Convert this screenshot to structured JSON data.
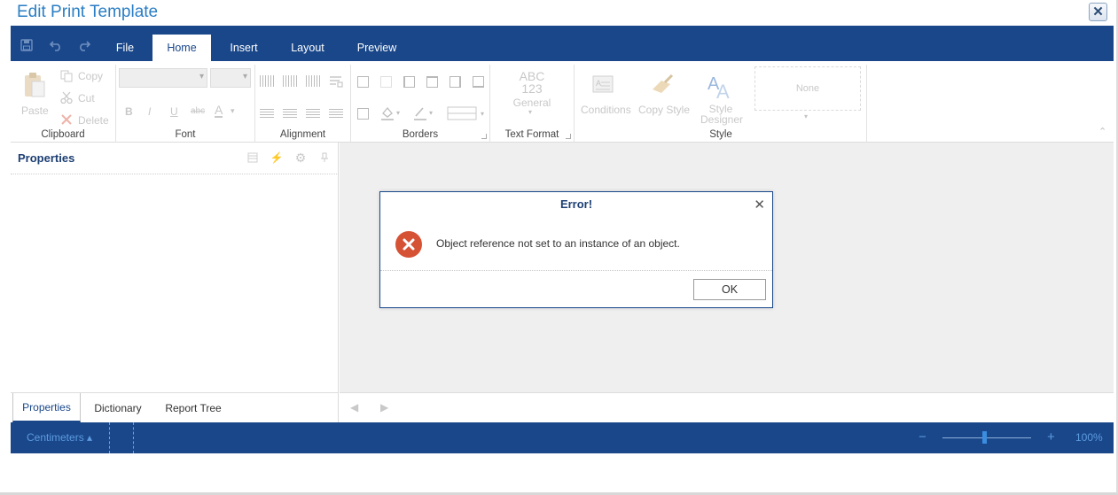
{
  "window": {
    "title": "Edit Print Template",
    "close_label": "✕"
  },
  "menu": {
    "tabs": [
      {
        "label": "File",
        "active": false
      },
      {
        "label": "Home",
        "active": true
      },
      {
        "label": "Insert",
        "active": false
      },
      {
        "label": "Layout",
        "active": false
      },
      {
        "label": "Preview",
        "active": false
      }
    ],
    "quick_access": [
      "save-icon",
      "undo-icon",
      "redo-icon"
    ]
  },
  "ribbon": {
    "clipboard": {
      "label": "Clipboard",
      "paste": "Paste",
      "copy": "Copy",
      "cut": "Cut",
      "delete": "Delete"
    },
    "font": {
      "label": "Font",
      "bold": "B",
      "italic": "I",
      "underline": "U",
      "strike": "abc",
      "color": "A"
    },
    "alignment": {
      "label": "Alignment"
    },
    "borders": {
      "label": "Borders"
    },
    "text_format": {
      "label": "Text Format",
      "abc": "ABC",
      "num": "123",
      "general": "General"
    },
    "style": {
      "label": "Style",
      "conditions": "Conditions",
      "copy_style": "Copy Style",
      "style_designer_1": "Style",
      "style_designer_2": "Designer",
      "none": "None"
    }
  },
  "properties": {
    "title": "Properties",
    "tabs": [
      {
        "label": "Properties",
        "active": true
      },
      {
        "label": "Dictionary",
        "active": false
      },
      {
        "label": "Report Tree",
        "active": false
      }
    ]
  },
  "status": {
    "units": "Centimeters ▴",
    "zoom_minus": "−",
    "zoom_plus": "+",
    "zoom": "100%",
    "zoom_level": 0.47
  },
  "dialog": {
    "title": "Error!",
    "message": "Object reference not set to an instance of an object.",
    "ok": "OK",
    "close": "✕"
  },
  "colors": {
    "brand": "#19478a",
    "error": "#d65235",
    "accent_text": "#2a7ec4"
  }
}
